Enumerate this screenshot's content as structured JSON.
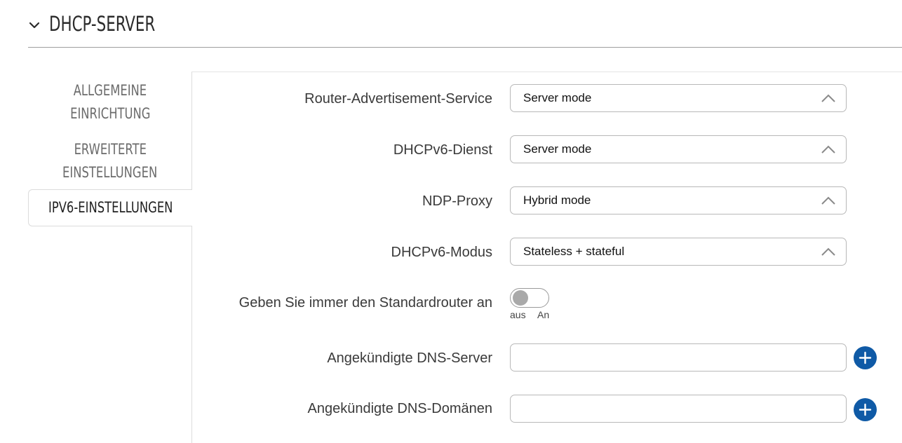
{
  "section": {
    "title": "DHCP-SERVER",
    "collapse_icon": "chevron-down-icon"
  },
  "sidebar": {
    "items": [
      {
        "line1": "ALLGEMEINE",
        "line2": "EINRICHTUNG",
        "active": false
      },
      {
        "line1": "ERWEITERTE",
        "line2": "EINSTELLUNGEN",
        "active": false
      },
      {
        "line1": "IPV6-EINSTELLUNGEN",
        "active": true
      }
    ]
  },
  "form": {
    "router_advertisement": {
      "label": "Router-Advertisement-Service",
      "value": "Server mode",
      "icon": "chevron-up-icon"
    },
    "dhcpv6_service": {
      "label": "DHCPv6-Dienst",
      "value": "Server mode",
      "icon": "chevron-up-icon"
    },
    "ndp_proxy": {
      "label": "NDP-Proxy",
      "value": "Hybrid mode",
      "icon": "chevron-up-icon"
    },
    "dhcpv6_mode": {
      "label": "DHCPv6-Modus",
      "value": "Stateless + stateful",
      "icon": "chevron-up-icon"
    },
    "default_router": {
      "label": "Geben Sie immer den Standardrouter an",
      "state": "off",
      "off_label": "aus",
      "on_label": "An"
    },
    "dns_servers": {
      "label": "Angekündigte DNS-Server",
      "value": "",
      "add_icon": "plus-icon"
    },
    "dns_domains": {
      "label": "Angekündigte DNS-Domänen",
      "value": "",
      "add_icon": "plus-icon"
    }
  },
  "colors": {
    "accent": "#0f5aa6",
    "toggle_knob": "#a9a9a9",
    "border": "#b8b8b8"
  }
}
